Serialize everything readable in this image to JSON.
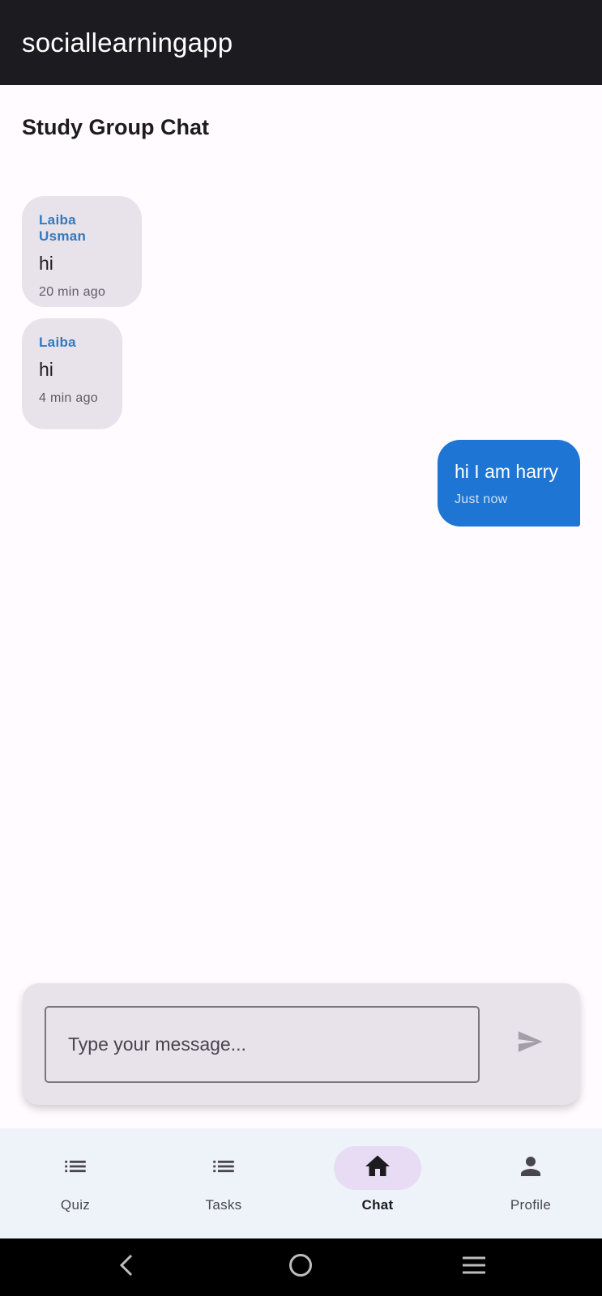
{
  "app": {
    "title": "sociallearningapp"
  },
  "page": {
    "title": "Study Group Chat"
  },
  "messages": [
    {
      "sender": "Laiba Usman",
      "text": "hi",
      "time": "20 min ago",
      "direction": "incoming"
    },
    {
      "sender": "Laiba",
      "text": "hi",
      "time": "4 min ago",
      "direction": "incoming"
    },
    {
      "text": "hi I am harry",
      "time": "Just now",
      "direction": "outgoing"
    }
  ],
  "composer": {
    "placeholder": "Type your message...",
    "value": "",
    "send_icon": "send-icon"
  },
  "nav": {
    "items": [
      {
        "label": "Quiz",
        "icon": "list-icon",
        "active": false
      },
      {
        "label": "Tasks",
        "icon": "list-icon",
        "active": false
      },
      {
        "label": "Chat",
        "icon": "home-icon",
        "active": true
      },
      {
        "label": "Profile",
        "icon": "person-icon",
        "active": false
      }
    ]
  },
  "system_nav": {
    "back_icon": "back-icon",
    "home_icon": "home-circle-icon",
    "recents_icon": "menu-icon"
  },
  "colors": {
    "appbar": "#1c1b20",
    "outgoing_bubble": "#1e75d4",
    "incoming_bubble": "#e8e2ea",
    "sender_name": "#2f7bc2",
    "nav_active_pill": "#e8dcf4"
  }
}
